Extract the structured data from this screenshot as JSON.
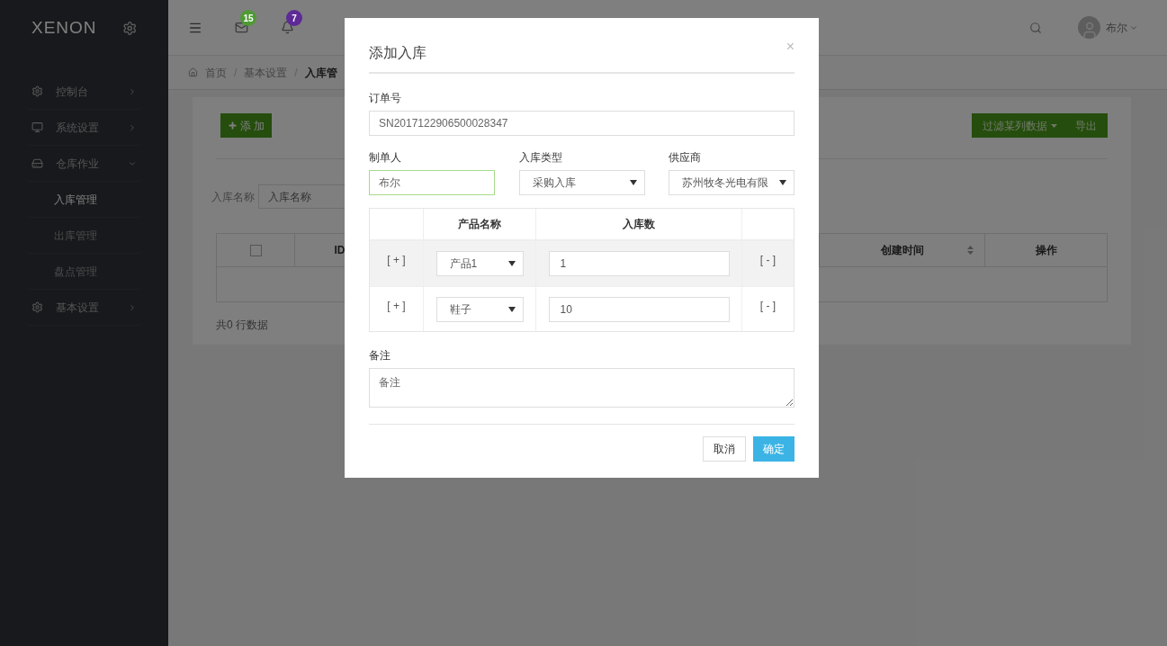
{
  "brand": {
    "logo": "XENON"
  },
  "sidebar": {
    "items": [
      {
        "label": "控制台",
        "expanded": false
      },
      {
        "label": "系统设置",
        "expanded": false
      },
      {
        "label": "仓库作业",
        "expanded": true,
        "children": [
          {
            "label": "入库管理",
            "selected": true
          },
          {
            "label": "出库管理",
            "selected": false
          },
          {
            "label": "盘点管理",
            "selected": false
          }
        ]
      },
      {
        "label": "基本设置",
        "expanded": false
      }
    ]
  },
  "header": {
    "notifications": [
      {
        "count": "15",
        "color": "#4f9a35"
      },
      {
        "count": "7",
        "color": "#5e2a96"
      }
    ],
    "user": {
      "name": "布尔"
    }
  },
  "breadcrumb": [
    {
      "label": "首页"
    },
    {
      "separator": "/",
      "label": "基本设置"
    },
    {
      "separator": "/",
      "label": "入库管"
    }
  ],
  "toolbar": {
    "add_button": "添 加",
    "filter_button": "过滤某列数据",
    "export_button": "导出"
  },
  "search": {
    "label": "入库名称",
    "placeholder": "入库名称"
  },
  "table": {
    "select_all_checked": false,
    "columns": [
      {
        "label": "ID"
      },
      {
        "label": "创建时间",
        "sortable": true
      },
      {
        "label": "操作",
        "sortable": false
      }
    ]
  },
  "footer": "共0 行数据",
  "modal": {
    "title": "添加入库",
    "close": "×",
    "order_no": {
      "label": "订单号",
      "value": "SN2017122906500028347"
    },
    "creator": {
      "label": "制单人",
      "value": "布尔",
      "focused": true
    },
    "type": {
      "label": "入库类型",
      "value": "采购入库"
    },
    "supplier": {
      "label": "供应商",
      "value": "苏州牧冬光电有限"
    },
    "items": {
      "columns": [
        {
          "label": "产品名称"
        },
        {
          "label": "入库数"
        }
      ],
      "rows": [
        {
          "add": "[ + ]",
          "product": "产品1",
          "quantity": "1",
          "remove": "[ - ]",
          "highlighted": true
        },
        {
          "add": "[ + ]",
          "product": "鞋子",
          "quantity": "10",
          "remove": "[ - ]",
          "highlighted": false
        }
      ]
    },
    "remark": {
      "label": "备注",
      "placeholder": "备注"
    },
    "cancel_button": "取消",
    "confirm_button": "确定"
  }
}
